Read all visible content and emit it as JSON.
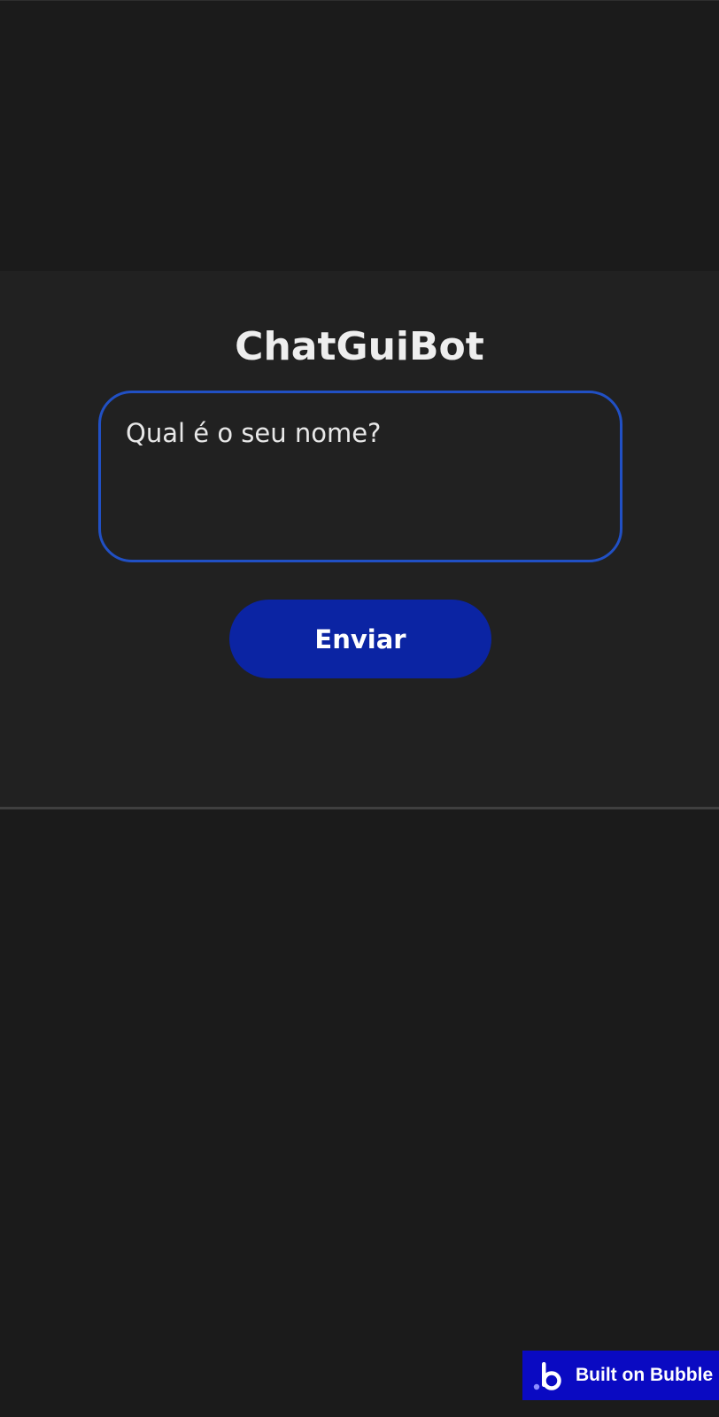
{
  "app": {
    "title": "ChatGuiBot"
  },
  "form": {
    "question_text": "Qual é o seu nome?",
    "send_label": "Enviar"
  },
  "footer": {
    "badge_label": "Built on Bubble",
    "badge_icon": "bubble-logo-icon"
  },
  "colors": {
    "background": "#1b1b1b",
    "panel": "#212121",
    "accent_border": "#2150c4",
    "button": "#0b24a3",
    "badge": "#0a0ac2"
  }
}
